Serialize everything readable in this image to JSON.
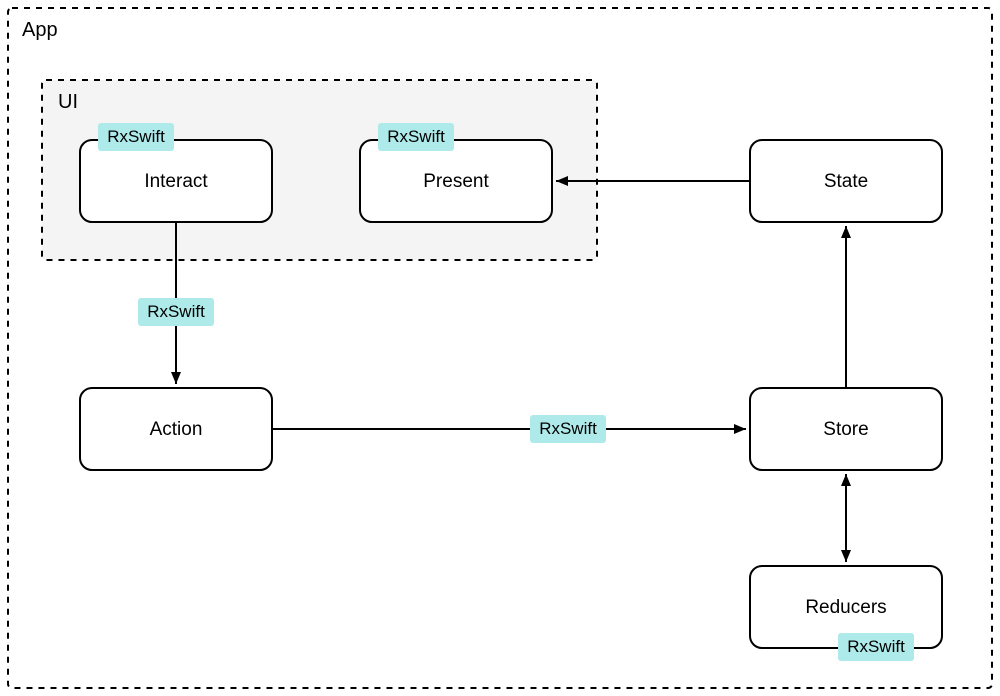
{
  "containers": {
    "app_label": "App",
    "ui_label": "UI"
  },
  "nodes": {
    "interact": "Interact",
    "present": "Present",
    "state": "State",
    "action": "Action",
    "store": "Store",
    "reducers": "Reducers"
  },
  "badges": {
    "interact": "RxSwift",
    "present": "RxSwift",
    "reducers": "RxSwift",
    "interact_to_action": "RxSwift",
    "action_to_store": "RxSwift"
  }
}
